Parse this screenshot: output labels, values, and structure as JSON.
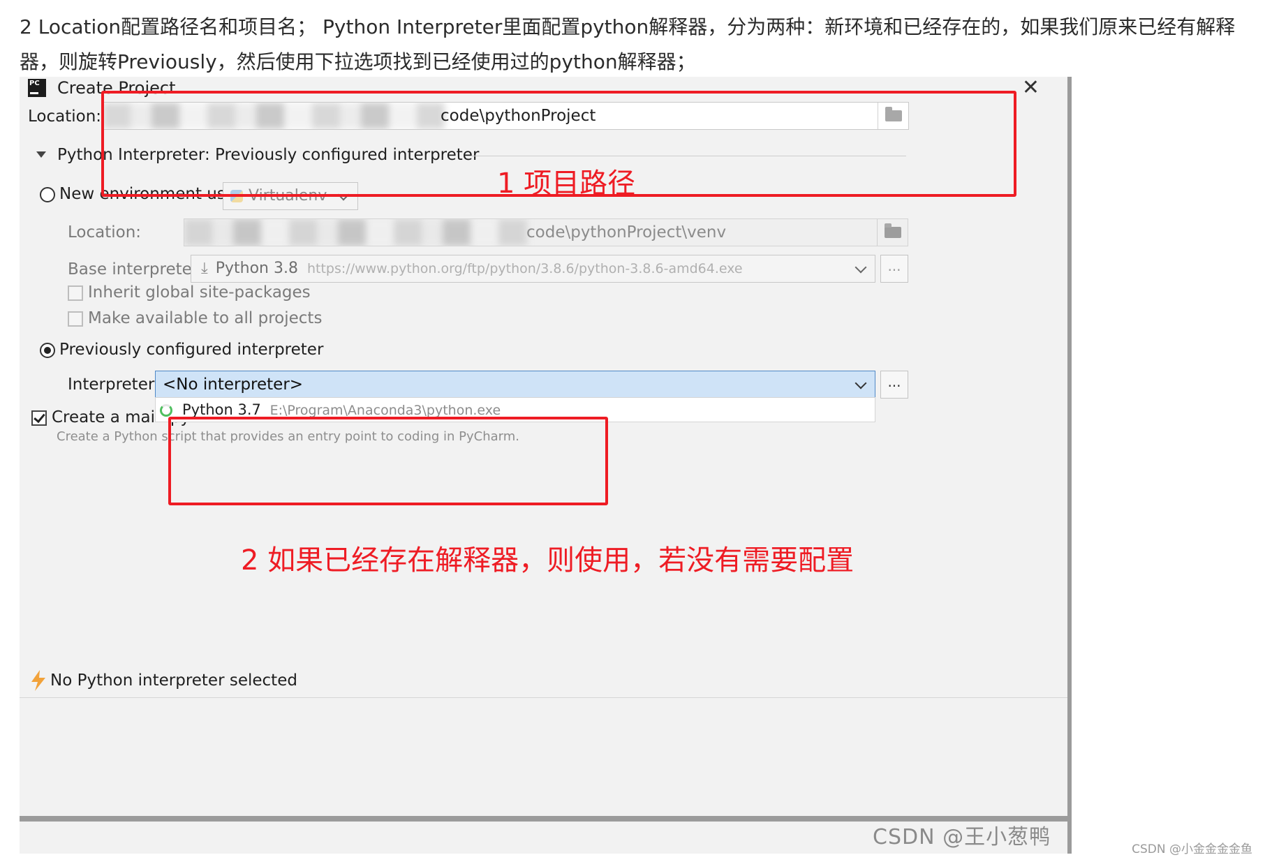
{
  "article": {
    "intro": "2 Location配置路径名和项目名； Python Interpreter里面配置python解释器，分为两种：新环境和已经存在的，如果我们原来已经有解释器，则旋转Previously，然后使用下拉选项找到已经使用过的python解释器；"
  },
  "dialog": {
    "title": "Create Project",
    "location_label": "Location:",
    "location_value": "code\\pythonProject",
    "interpreter_section": "Python Interpreter: Previously configured interpreter",
    "new_env": {
      "radio_label": "New environment using",
      "tool": "Virtualenv",
      "location_label": "Location:",
      "location_value": "code\\pythonProject\\venv",
      "base_label": "Base interpreter:",
      "base_name": "Python 3.8",
      "base_url": "https://www.python.org/ftp/python/3.8.6/python-3.8.6-amd64.exe",
      "inherit_label": "Inherit global site-packages",
      "available_label": "Make available to all projects"
    },
    "previous": {
      "radio_label": "Previously configured interpreter",
      "interpreter_label": "Interpreter:",
      "interpreter_value": "<No interpreter>",
      "option_name": "Python 3.7",
      "option_path": "E:\\Program\\Anaconda3\\python.exe"
    },
    "create_main_label": "Create a main.py",
    "create_main_hint": "Create a Python script that provides an entry point to coding in PyCharm.",
    "status": "No Python interpreter selected",
    "more_button": "..."
  },
  "annotations": {
    "label1": "1 项目路径",
    "label2": "2 如果已经存在解释器，则使用，若没有需要配置",
    "color": "#ee1c24"
  },
  "watermark": {
    "main": "CSDN @王小葱鸭",
    "tag": "CSDN @小金金金金鱼"
  }
}
